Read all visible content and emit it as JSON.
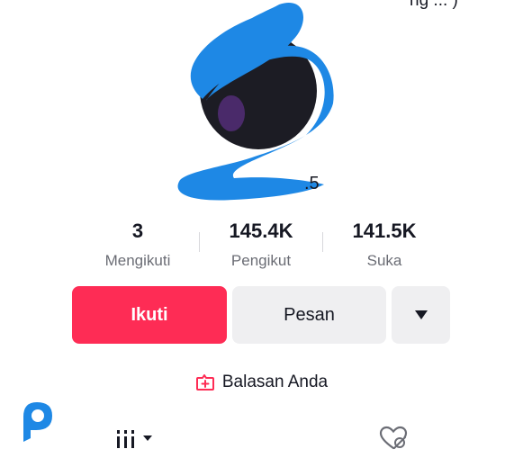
{
  "top": {
    "text": "ng ... )"
  },
  "profile": {
    "username_fragment": ".5"
  },
  "stats": [
    {
      "value": "3",
      "label": "Mengikuti"
    },
    {
      "value": "145.4K",
      "label": "Pengikut"
    },
    {
      "value": "141.5K",
      "label": "Suka"
    }
  ],
  "actions": {
    "follow_label": "Ikuti",
    "message_label": "Pesan",
    "more_icon": "caret-down-icon"
  },
  "replies": {
    "label": "Balasan Anda",
    "icon": "reply-plus-icon"
  },
  "tabs": [
    {
      "icon": "grid-bars-icon"
    },
    {
      "icon": "liked-hidden-icon"
    }
  ],
  "colors": {
    "accent": "#fe2c55",
    "secondary_button": "#efeff1",
    "redaction": "#1e88e5",
    "logo": "#1e88e5"
  }
}
